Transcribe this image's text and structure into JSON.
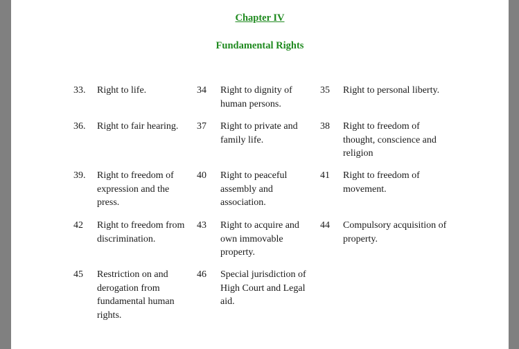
{
  "document": {
    "chapter_heading": "Chapter IV",
    "section_title": "Fundamental Rights",
    "accent_color": "#1f8a1f",
    "sections": [
      {
        "number": "33.",
        "title": "Right to life."
      },
      {
        "number": "34",
        "title": "Right to dignity of human persons."
      },
      {
        "number": "35",
        "title": "Right to personal liberty."
      },
      {
        "number": "36.",
        "title": "Right to fair hearing."
      },
      {
        "number": "37",
        "title": "Right to private and family life."
      },
      {
        "number": "38",
        "title": "Right to freedom of thought, conscience and religion"
      },
      {
        "number": "39.",
        "title": "Right to freedom of expression and the press."
      },
      {
        "number": "40",
        "title": "Right to peaceful assembly and association."
      },
      {
        "number": "41",
        "title": "Right to freedom of movement."
      },
      {
        "number": "42",
        "title": "Right to freedom from discrimination."
      },
      {
        "number": "43",
        "title": "Right to acquire and own immovable property."
      },
      {
        "number": "44",
        "title": "Compulsory acquisition of property."
      },
      {
        "number": "45",
        "title": "Restriction on and derogation from fundamental human rights."
      },
      {
        "number": "46",
        "title": "Special jurisdiction of High Court and Legal aid."
      }
    ]
  }
}
